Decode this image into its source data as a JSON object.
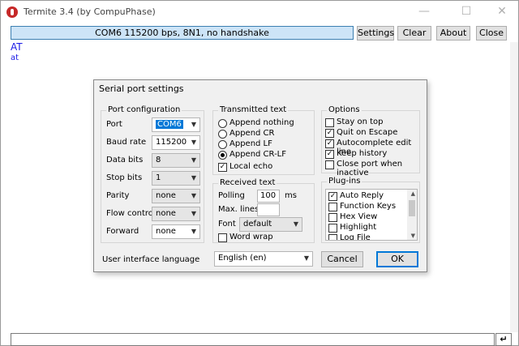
{
  "window": {
    "title": "Termite 3.4 (by CompuPhase)",
    "minimize_glyph": "—",
    "maximize_glyph": "☐",
    "close_glyph": "✕"
  },
  "toolbar": {
    "status": "COM6 115200 bps, 8N1, no handshake",
    "settings_label": "Settings",
    "clear_label": "Clear",
    "about_label": "About",
    "close_label": "Close"
  },
  "terminal": {
    "lines": [
      "AT",
      "at"
    ]
  },
  "input": {
    "value": "",
    "send_glyph": "↵"
  },
  "dialog": {
    "title": "Serial port settings",
    "port_config": {
      "label": "Port configuration",
      "port_label": "Port",
      "port_value": "COM6",
      "baud_label": "Baud rate",
      "baud_value": "115200",
      "databits_label": "Data bits",
      "databits_value": "8",
      "stopbits_label": "Stop bits",
      "stopbits_value": "1",
      "parity_label": "Parity",
      "parity_value": "none",
      "flow_label": "Flow control",
      "flow_value": "none",
      "forward_label": "Forward",
      "forward_value": "none"
    },
    "transmitted": {
      "label": "Transmitted text",
      "options": [
        {
          "label": "Append nothing",
          "selected": false
        },
        {
          "label": "Append CR",
          "selected": false
        },
        {
          "label": "Append LF",
          "selected": false
        },
        {
          "label": "Append CR-LF",
          "selected": true
        }
      ],
      "local_echo_label": "Local echo",
      "local_echo_checked": true
    },
    "received": {
      "label": "Received text",
      "polling_label": "Polling",
      "polling_value": "100",
      "polling_unit": "ms",
      "maxlines_label": "Max. lines",
      "maxlines_value": "",
      "font_label": "Font",
      "font_value": "default",
      "wordwrap_label": "Word wrap",
      "wordwrap_checked": false
    },
    "options": {
      "label": "Options",
      "items": [
        {
          "label": "Stay on top",
          "checked": false
        },
        {
          "label": "Quit on Escape",
          "checked": true
        },
        {
          "label": "Autocomplete edit line",
          "checked": true
        },
        {
          "label": "Keep history",
          "checked": true
        },
        {
          "label": "Close port when inactive",
          "checked": false
        }
      ]
    },
    "plugins": {
      "label": "Plug-ins",
      "items": [
        {
          "label": "Auto Reply",
          "checked": true
        },
        {
          "label": "Function Keys",
          "checked": false
        },
        {
          "label": "Hex View",
          "checked": false
        },
        {
          "label": "Highlight",
          "checked": false
        },
        {
          "label": "Log File",
          "checked": false
        }
      ]
    },
    "language_label": "User interface language",
    "language_value": "English (en)",
    "cancel_label": "Cancel",
    "ok_label": "OK"
  },
  "colors": {
    "terminal_text": "#1a1ae6",
    "status_bg": "#cde4f7",
    "focus_blue": "#0078d7"
  },
  "icons": [
    "termite-app-icon",
    "chevron-down-icon",
    "enter-icon",
    "checkmark-icon"
  ]
}
